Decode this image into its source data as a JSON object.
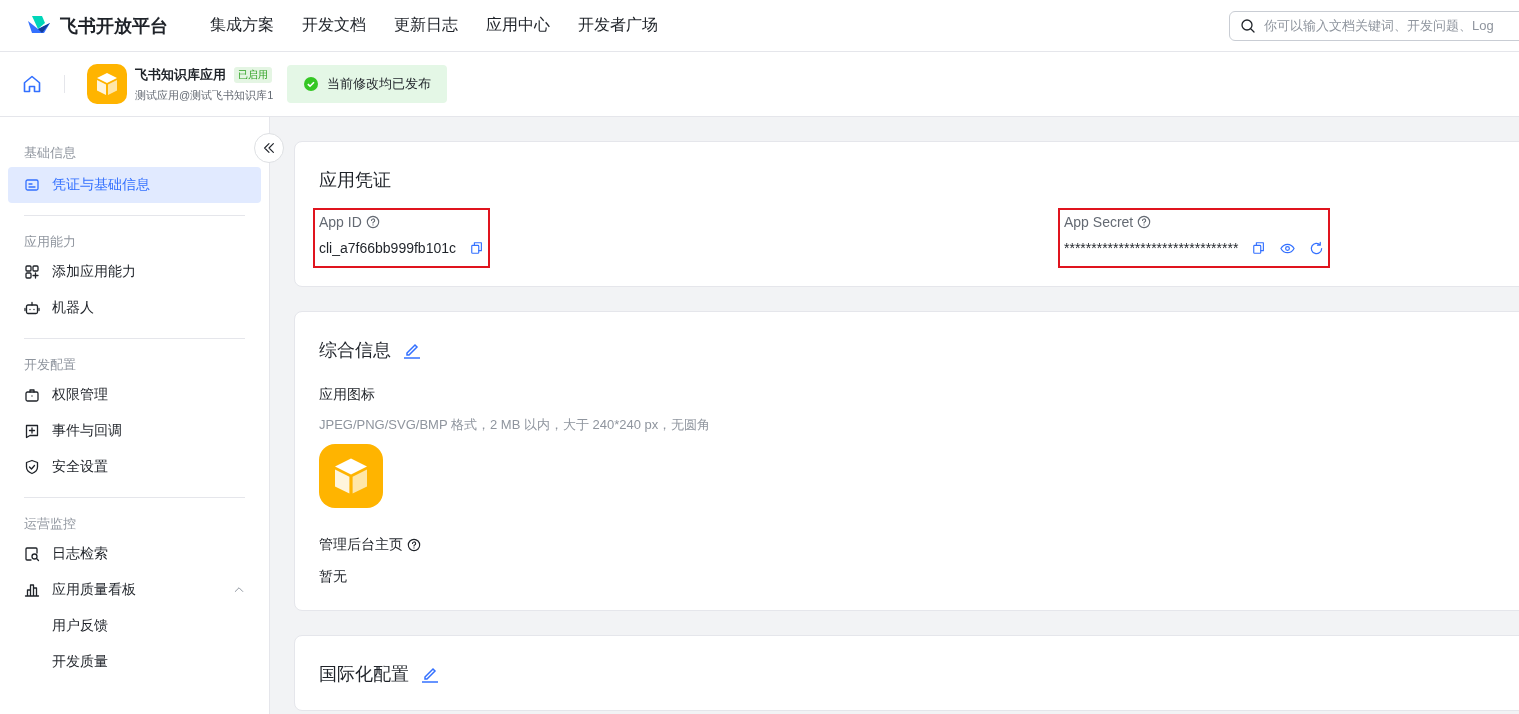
{
  "header": {
    "brand": "飞书开放平台",
    "nav": [
      "集成方案",
      "开发文档",
      "更新日志",
      "应用中心",
      "开发者广场"
    ],
    "search": {
      "placeholder": "你可以输入文档关键词、开发问题、Log"
    }
  },
  "app_bar": {
    "app_name": "飞书知识库应用",
    "status_badge": "已启用",
    "subtitle": "测试应用@测试飞书知识库1",
    "publish_status": "当前修改均已发布"
  },
  "sidebar": {
    "sections": [
      {
        "title": "基础信息",
        "items": [
          {
            "label": "凭证与基础信息",
            "selected": true
          }
        ]
      },
      {
        "title": "应用能力",
        "items": [
          {
            "label": "添加应用能力",
            "selected": false
          },
          {
            "label": "机器人",
            "selected": false
          }
        ]
      },
      {
        "title": "开发配置",
        "items": [
          {
            "label": "权限管理",
            "selected": false
          },
          {
            "label": "事件与回调",
            "selected": false
          },
          {
            "label": "安全设置",
            "selected": false
          }
        ]
      },
      {
        "title": "运营监控",
        "items": [
          {
            "label": "日志检索",
            "selected": false
          },
          {
            "label": "应用质量看板",
            "selected": false,
            "expanded": true,
            "children": [
              {
                "label": "用户反馈",
                "selected": false
              },
              {
                "label": "开发质量",
                "selected": false
              }
            ]
          }
        ]
      }
    ]
  },
  "credentials": {
    "title": "应用凭证",
    "fields": [
      {
        "kind": "id",
        "label": "App ID",
        "value": "cli_a7f66bb999fb101c",
        "highlighted": true
      },
      {
        "kind": "secret",
        "label": "App Secret",
        "value": "********************************",
        "highlighted": true
      }
    ]
  },
  "general_info": {
    "title": "综合信息",
    "icon_label": "应用图标",
    "icon_hint": "JPEG/PNG/SVG/BMP 格式，2 MB 以内，大于 240*240 px，无圆角",
    "admin_home_label": "管理后台主页",
    "admin_home_value": "暂无"
  },
  "i18n": {
    "title": "国际化配置"
  }
}
